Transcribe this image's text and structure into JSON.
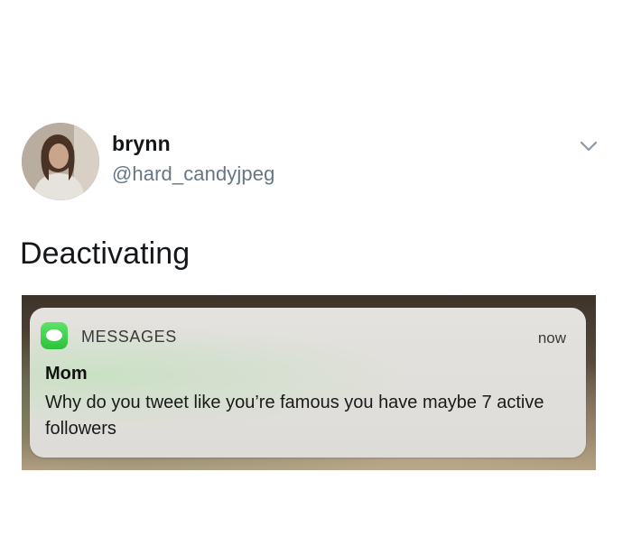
{
  "tweet": {
    "display_name": "brynn",
    "handle": "@hard_candyjpeg",
    "text": "Deactivating",
    "menu_icon": "chevron-down-icon",
    "avatar_icon": "profile-photo"
  },
  "notification": {
    "app_name": "MESSAGES",
    "app_icon": "messages-app-icon",
    "time": "now",
    "sender": "Mom",
    "body": "Why do you tweet like you’re famous you have maybe 7 active followers",
    "accent_color": "#2dc23b"
  }
}
